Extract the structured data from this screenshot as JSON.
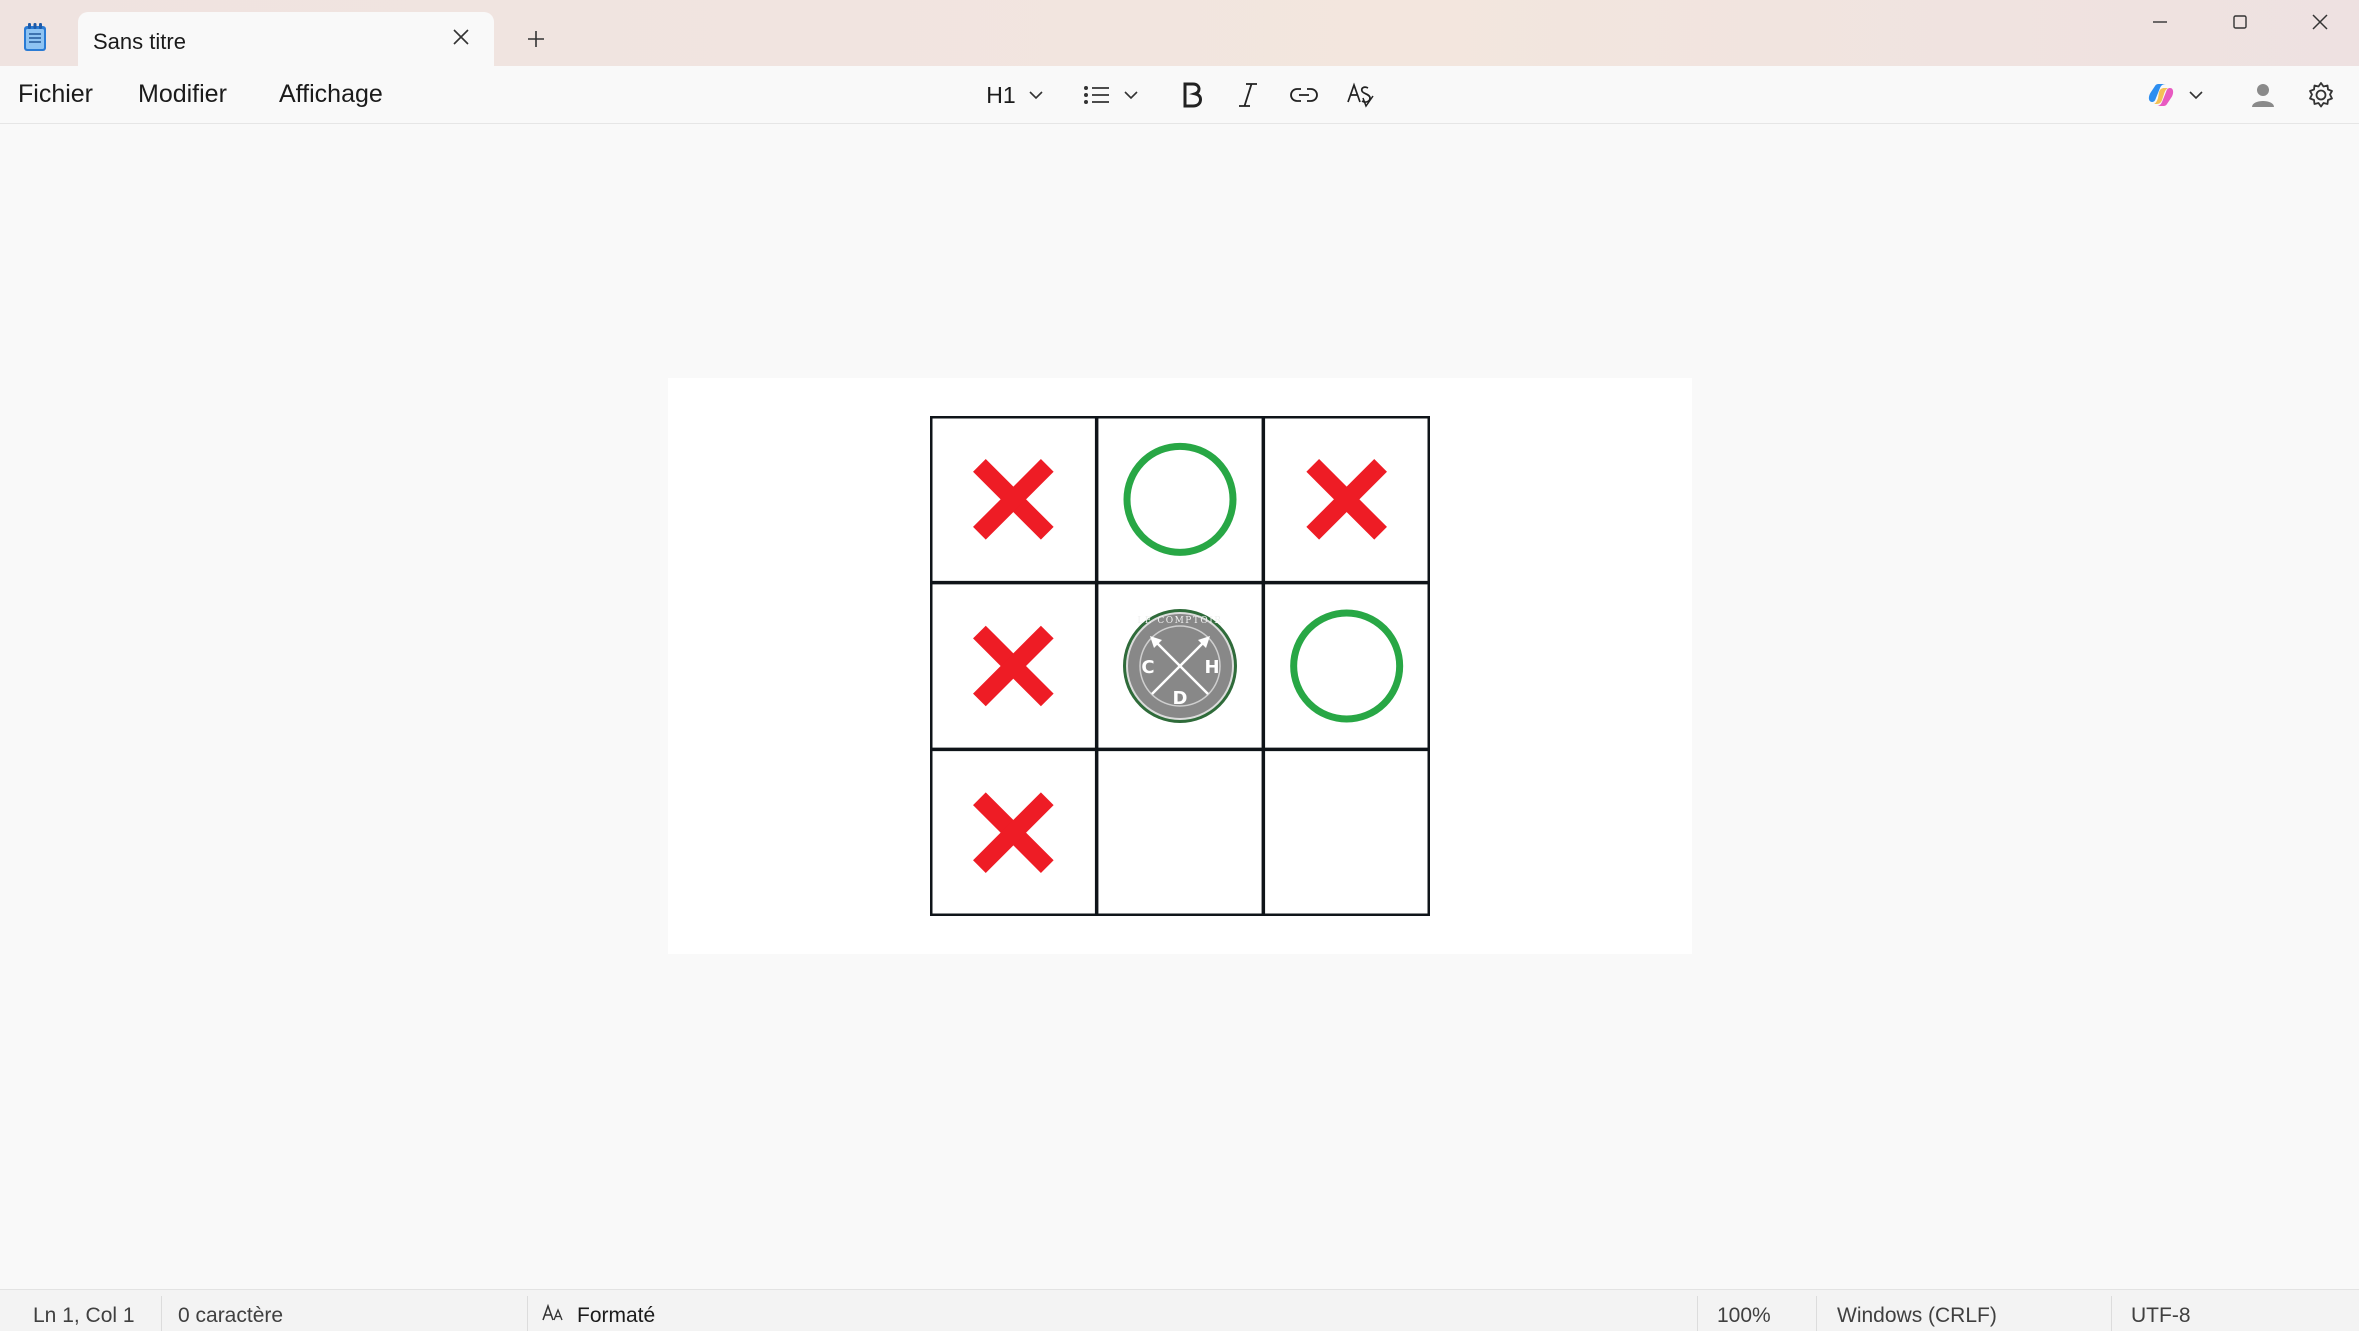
{
  "window": {
    "tab_title": "Sans titre"
  },
  "menu": {
    "items": [
      "Fichier",
      "Modifier",
      "Affichage"
    ]
  },
  "toolbar": {
    "heading_label": "H1"
  },
  "board": {
    "cells": [
      "X",
      "O",
      "X",
      "X",
      "logo",
      "O",
      "X",
      "",
      ""
    ],
    "logo_letters": [
      "C",
      "H",
      "D"
    ],
    "logo_ring_text": "LE COMPTOIR",
    "colors": {
      "x": "#ee1c25",
      "o": "#28a745",
      "grid": "#0f1419",
      "logo": "#888888"
    }
  },
  "status": {
    "position": "Ln 1, Col 1",
    "chars": "0 caractère",
    "format": "Formaté",
    "zoom": "100%",
    "line_ending": "Windows (CRLF)",
    "encoding": "UTF-8"
  },
  "accent": "#0067c0"
}
